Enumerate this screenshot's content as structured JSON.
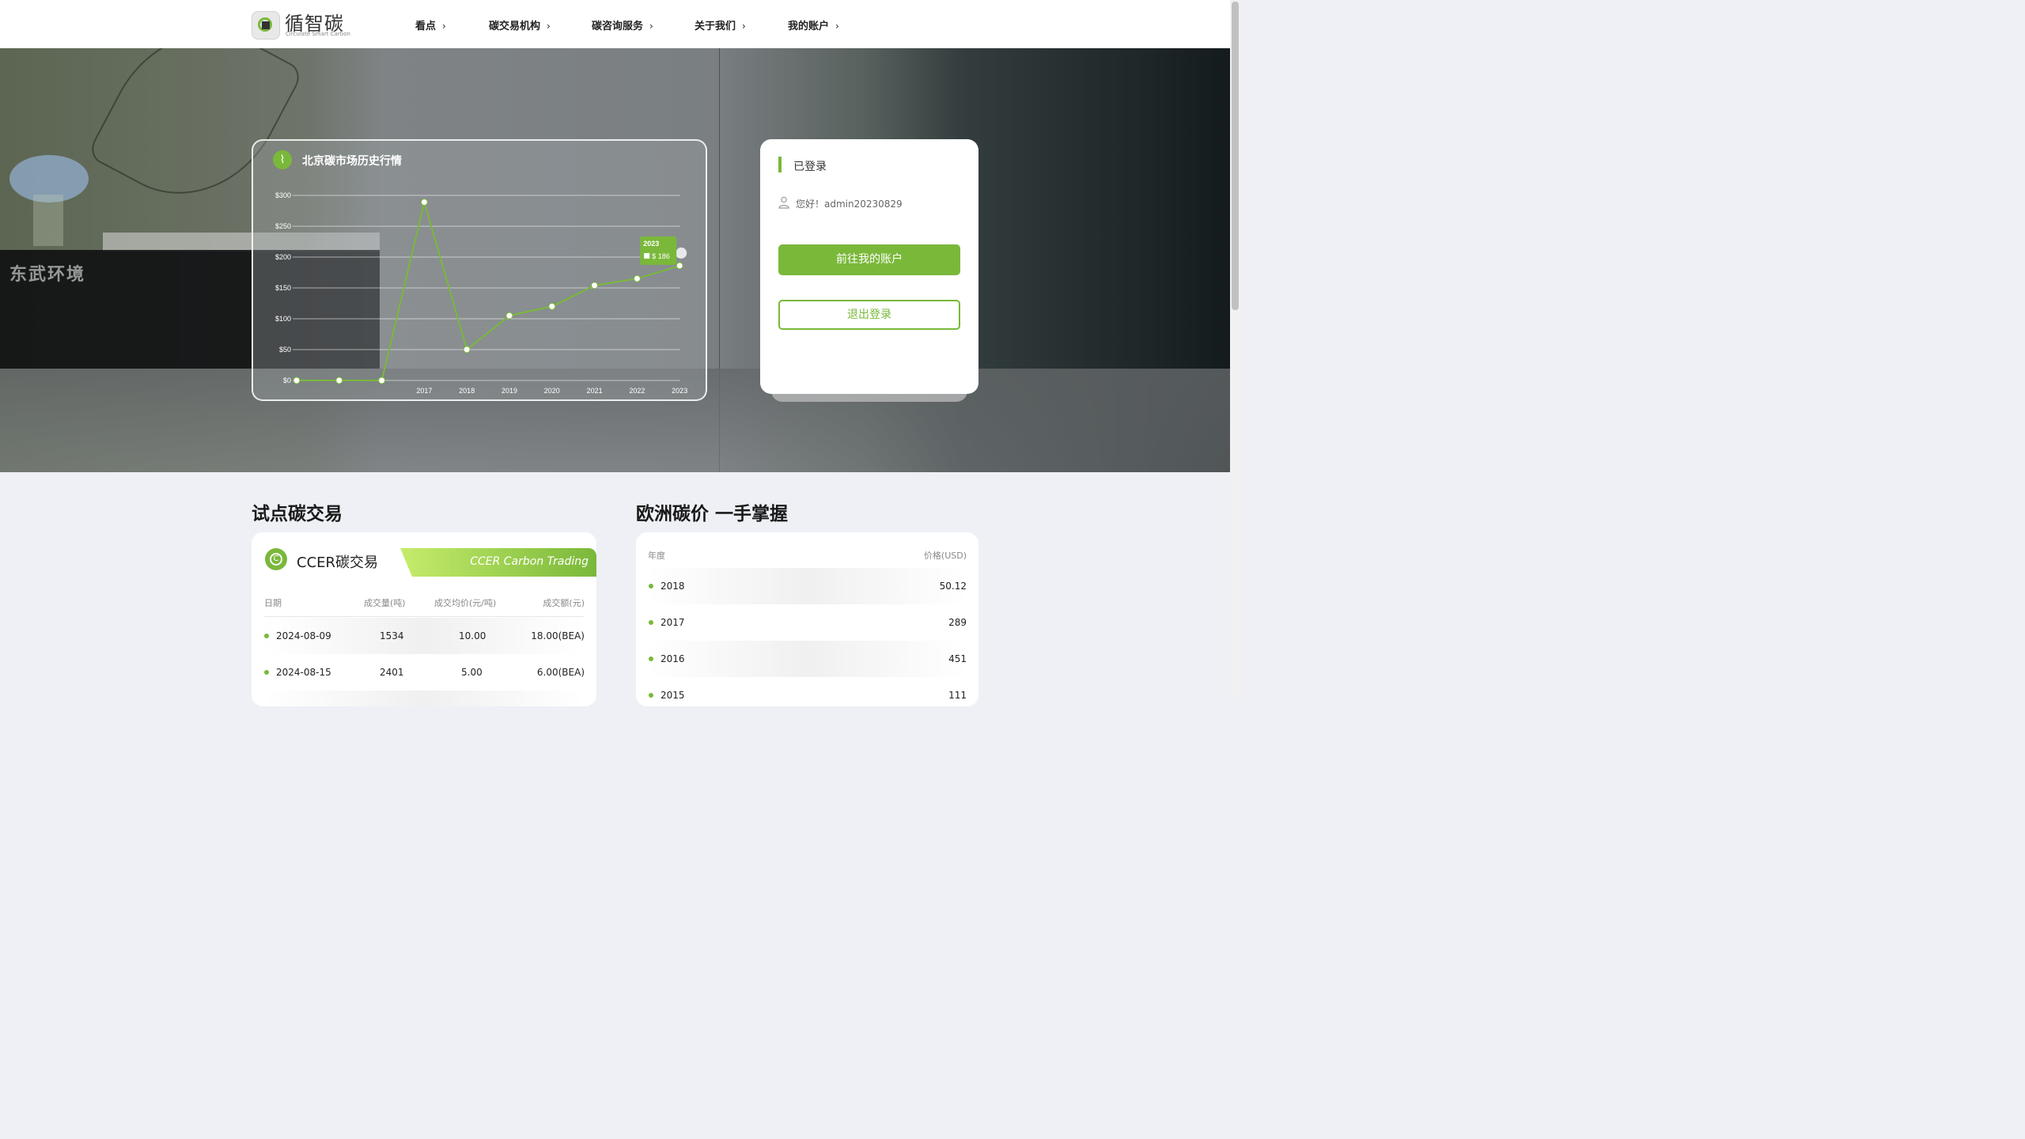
{
  "brand": {
    "name_cn": "循智碳",
    "name_en": "Circulate Smart Carbon"
  },
  "nav": [
    {
      "label": "看点"
    },
    {
      "label": "碳交易机构"
    },
    {
      "label": "碳咨询服务"
    },
    {
      "label": "关于我们"
    },
    {
      "label": "我的账户"
    }
  ],
  "nav_chevron": "›",
  "hero_sign": "东武环境",
  "chart_panel": {
    "title": "北京碳市场历史行情"
  },
  "chart_data": {
    "type": "line",
    "title": "北京碳市场历史行情",
    "y_ticks": [
      "$0",
      "$50",
      "$100",
      "$150",
      "$200",
      "$250",
      "$300"
    ],
    "ylim": [
      0,
      300
    ],
    "x_labels": [
      "2017",
      "2018",
      "2019",
      "2020",
      "2021",
      "2022",
      "2023"
    ],
    "points": [
      {
        "x": null,
        "y": 0
      },
      {
        "x": null,
        "y": 0
      },
      {
        "x": null,
        "y": 0
      },
      {
        "x": "2017",
        "y": 289
      },
      {
        "x": "2018",
        "y": 50.12
      },
      {
        "x": "2019",
        "y": 105
      },
      {
        "x": "2020",
        "y": 120
      },
      {
        "x": "2021",
        "y": 154
      },
      {
        "x": "2022",
        "y": 165
      },
      {
        "x": "2023",
        "y": 186
      }
    ],
    "grid": true,
    "line_color": "#7ab83a",
    "tooltip": {
      "year": "2023",
      "label": "$",
      "value": "186"
    }
  },
  "login": {
    "title": "已登录",
    "greeting": "您好！admin20230829",
    "primary_button": "前往我的账户",
    "logout_button": "退出登录"
  },
  "pilot": {
    "section_title": "试点碳交易",
    "card_title": "CCER碳交易",
    "ribbon_text": "CCER Carbon Trading",
    "icon_letter": "C",
    "columns": [
      "日期",
      "成交量(吨)",
      "成交均价(元/吨)",
      "成交额(元)"
    ],
    "rows": [
      {
        "date": "2024-08-09",
        "volume": "1534",
        "avg_price": "10.00",
        "amount": "18.00(BEA)"
      },
      {
        "date": "2024-08-15",
        "volume": "2401",
        "avg_price": "5.00",
        "amount": "6.00(BEA)"
      }
    ]
  },
  "eu": {
    "section_title": "欧洲碳价 一手掌握",
    "columns": [
      "年度",
      "价格(USD)"
    ],
    "rows": [
      {
        "year": "2018",
        "price": "50.12"
      },
      {
        "year": "2017",
        "price": "289"
      },
      {
        "year": "2016",
        "price": "451"
      },
      {
        "year": "2015",
        "price": "111"
      }
    ]
  },
  "colors": {
    "accent": "#7ab83a",
    "accent_light": "#c6ec6b"
  }
}
